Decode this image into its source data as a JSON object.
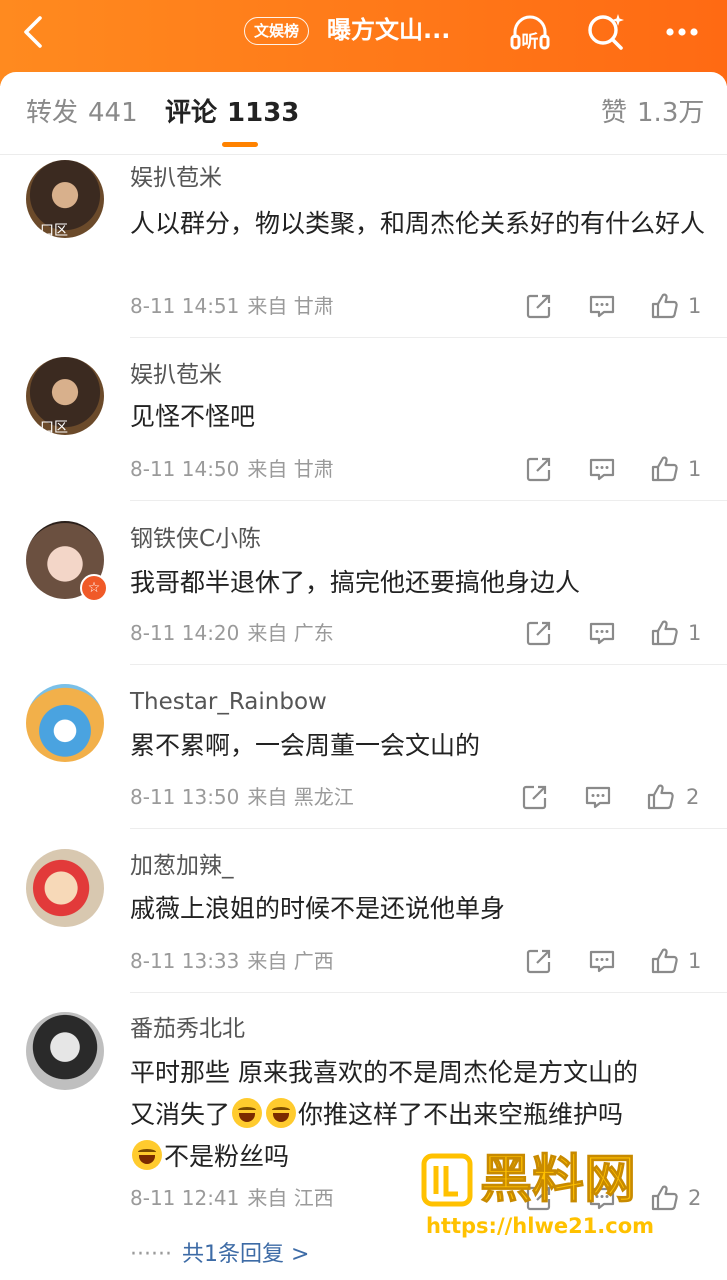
{
  "header": {
    "back_icon": "chevron-left-icon",
    "tag": "文娱榜",
    "title": "曝方文山...",
    "listen_label": "听",
    "search_icon": "search-sparkle-icon",
    "more_icon": "more-dots-icon"
  },
  "tabs": {
    "repost_label": "转发",
    "repost_count": "441",
    "comment_label": "评论",
    "comment_count": "1133",
    "like_label": "赞",
    "like_count": "1.3万",
    "accent": "#ff8200"
  },
  "comments": [
    {
      "user": "娱扒苞米",
      "text": "人以群分，物以类聚，和周杰伦关系好的有什么好人",
      "time": "8-11 14:51",
      "from": "来自 甘肃",
      "likes": "1",
      "avatar_label": "口区"
    },
    {
      "user": "娱扒苞米",
      "text": "见怪不怪吧",
      "time": "8-11 14:50",
      "from": "来自 甘肃",
      "likes": "1",
      "avatar_label": "口区"
    },
    {
      "user": "钢铁侠C小陈",
      "text": "我哥都半退休了，搞完他还要搞他身边人",
      "time": "8-11 14:20",
      "from": "来自 广东",
      "likes": "1"
    },
    {
      "user": "Thestar_Rainbow",
      "text": "累不累啊，一会周董一会文山的",
      "time": "8-11 13:50",
      "from": "来自 黑龙江",
      "likes": "2"
    },
    {
      "user": "加葱加辣_",
      "text": "戚薇上浪姐的时候不是还说他单身",
      "time": "8-11 13:33",
      "from": "来自 广西",
      "likes": "1"
    },
    {
      "user": "番茄秀北北",
      "text_1": "平时那些 原来我喜欢的不是周杰伦是方文山的",
      "text_2a": "又消失了",
      "text_2b": "你推这样了不出来空瓶维护吗",
      "text_3": "不是粉丝吗",
      "time": "8-11 12:41",
      "from": "来自 江西",
      "likes": "2",
      "emoji_icon": "laugh-cry-emoji-icon"
    }
  ],
  "reply_link": {
    "dots": "······",
    "label": "共1条回复 >"
  },
  "watermark": {
    "title": "黑料网",
    "url": "https://hlwe21.com"
  },
  "icons": {
    "share": "share-icon",
    "comment": "comment-icon",
    "like": "thumbs-up-icon"
  }
}
